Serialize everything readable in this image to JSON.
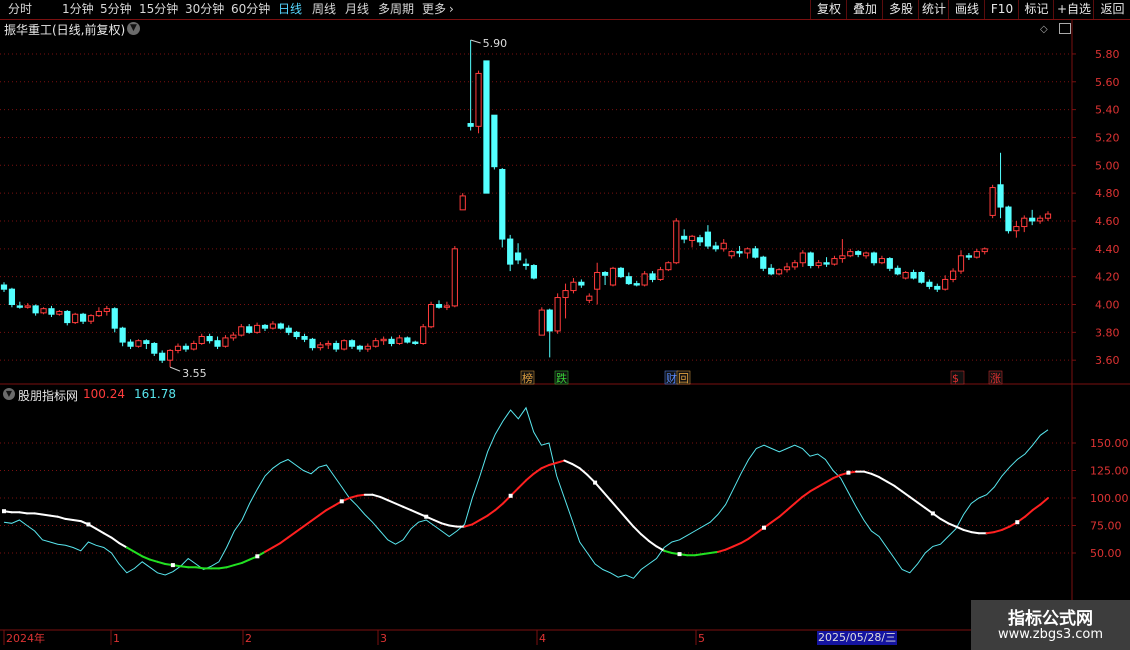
{
  "toolbar": {
    "periods": [
      "分时",
      "1分钟",
      "5分钟",
      "15分钟",
      "30分钟",
      "60分钟",
      "日线",
      "周线",
      "月线",
      "多周期",
      "更多"
    ],
    "active_period": "日线",
    "right_buttons": [
      "复权",
      "叠加",
      "多股",
      "统计",
      "画线",
      "F10",
      "标记",
      "+自选",
      "返回"
    ]
  },
  "main_chart": {
    "title": "振华重工(日线,前复权)",
    "y_ticks": [
      "5.80",
      "5.60",
      "5.40",
      "5.20",
      "5.00",
      "4.80",
      "4.60",
      "4.40",
      "4.20",
      "4.00",
      "3.80",
      "3.60"
    ],
    "high_label": "5.90",
    "low_label": "3.55",
    "event_markers": [
      {
        "text": "榜",
        "color": "#e0a040"
      },
      {
        "text": "跌",
        "color": "#36d336"
      },
      {
        "text": "财",
        "color": "#5a8cff"
      },
      {
        "text": "回",
        "color": "#e0a040"
      },
      {
        "text": "$",
        "color": "#e03030"
      },
      {
        "text": "涨",
        "color": "#e03030"
      }
    ]
  },
  "indicator": {
    "name": "股朋指标网",
    "value_red": "100.24",
    "value_cyan": "161.78",
    "y_ticks": [
      "150.00",
      "125.00",
      "100.00",
      "75.00",
      "50.00"
    ]
  },
  "date_axis": {
    "labels": [
      "2024年",
      "1",
      "2",
      "3",
      "4",
      "5"
    ],
    "cursor_date": "2025/05/28/三"
  },
  "watermark": {
    "title": "指标公式网",
    "url": "www.zbgs3.com"
  },
  "colors": {
    "up": "#ff3c3c",
    "down": "#54ffff",
    "grid": "#7a1010",
    "ma_white": "#ffffff",
    "ma_red": "#ff2020",
    "ma_green": "#22e022",
    "osc": "#58e6ee"
  },
  "chart_data": {
    "type": "candlestick",
    "title": "振华重工(日线,前复权)",
    "ylim": [
      3.52,
      5.95
    ],
    "candles": [
      [
        4.14,
        4.16,
        4.09,
        4.11
      ],
      [
        4.11,
        4.12,
        3.98,
        4.0
      ],
      [
        3.99,
        4.02,
        3.97,
        3.98
      ],
      [
        3.98,
        4.01,
        3.97,
        3.99
      ],
      [
        3.99,
        4.0,
        3.92,
        3.94
      ],
      [
        3.94,
        3.98,
        3.93,
        3.97
      ],
      [
        3.97,
        3.99,
        3.91,
        3.93
      ],
      [
        3.93,
        3.96,
        3.92,
        3.95
      ],
      [
        3.95,
        3.96,
        3.85,
        3.87
      ],
      [
        3.87,
        3.94,
        3.86,
        3.93
      ],
      [
        3.93,
        3.94,
        3.86,
        3.88
      ],
      [
        3.88,
        3.93,
        3.86,
        3.92
      ],
      [
        3.92,
        3.98,
        3.91,
        3.95
      ],
      [
        3.95,
        3.99,
        3.92,
        3.97
      ],
      [
        3.97,
        3.98,
        3.8,
        3.83
      ],
      [
        3.83,
        3.84,
        3.7,
        3.73
      ],
      [
        3.73,
        3.75,
        3.68,
        3.7
      ],
      [
        3.7,
        3.75,
        3.69,
        3.74
      ],
      [
        3.74,
        3.75,
        3.68,
        3.72
      ],
      [
        3.72,
        3.73,
        3.63,
        3.65
      ],
      [
        3.65,
        3.67,
        3.58,
        3.6
      ],
      [
        3.6,
        3.68,
        3.55,
        3.67
      ],
      [
        3.67,
        3.72,
        3.65,
        3.7
      ],
      [
        3.7,
        3.72,
        3.66,
        3.68
      ],
      [
        3.68,
        3.74,
        3.67,
        3.72
      ],
      [
        3.72,
        3.79,
        3.71,
        3.77
      ],
      [
        3.77,
        3.79,
        3.72,
        3.74
      ],
      [
        3.74,
        3.77,
        3.68,
        3.7
      ],
      [
        3.7,
        3.78,
        3.69,
        3.76
      ],
      [
        3.76,
        3.8,
        3.74,
        3.78
      ],
      [
        3.78,
        3.86,
        3.77,
        3.84
      ],
      [
        3.84,
        3.86,
        3.79,
        3.8
      ],
      [
        3.8,
        3.87,
        3.79,
        3.85
      ],
      [
        3.85,
        3.86,
        3.81,
        3.83
      ],
      [
        3.83,
        3.88,
        3.82,
        3.86
      ],
      [
        3.86,
        3.87,
        3.82,
        3.83
      ],
      [
        3.83,
        3.85,
        3.78,
        3.8
      ],
      [
        3.8,
        3.81,
        3.75,
        3.77
      ],
      [
        3.77,
        3.79,
        3.73,
        3.75
      ],
      [
        3.75,
        3.76,
        3.67,
        3.69
      ],
      [
        3.69,
        3.73,
        3.67,
        3.71
      ],
      [
        3.71,
        3.74,
        3.68,
        3.72
      ],
      [
        3.72,
        3.74,
        3.66,
        3.68
      ],
      [
        3.68,
        3.75,
        3.67,
        3.74
      ],
      [
        3.74,
        3.75,
        3.68,
        3.7
      ],
      [
        3.7,
        3.71,
        3.66,
        3.68
      ],
      [
        3.68,
        3.72,
        3.66,
        3.7
      ],
      [
        3.7,
        3.76,
        3.69,
        3.74
      ],
      [
        3.74,
        3.77,
        3.71,
        3.75
      ],
      [
        3.75,
        3.77,
        3.7,
        3.72
      ],
      [
        3.72,
        3.78,
        3.71,
        3.76
      ],
      [
        3.76,
        3.77,
        3.72,
        3.73
      ],
      [
        3.73,
        3.74,
        3.71,
        3.72
      ],
      [
        3.72,
        3.86,
        3.71,
        3.84
      ],
      [
        3.84,
        4.02,
        3.83,
        4.0
      ],
      [
        4.0,
        4.03,
        3.97,
        3.98
      ],
      [
        3.98,
        4.02,
        3.96,
        3.99
      ],
      [
        3.99,
        4.42,
        3.98,
        4.4
      ],
      [
        4.68,
        4.8,
        4.69,
        4.78
      ],
      [
        5.3,
        5.9,
        5.25,
        5.28
      ],
      [
        5.28,
        5.68,
        5.23,
        5.66
      ],
      [
        5.75,
        5.75,
        4.8,
        4.8
      ],
      [
        5.36,
        5.36,
        4.97,
        4.99
      ],
      [
        4.97,
        4.98,
        4.41,
        4.47
      ],
      [
        4.47,
        4.5,
        4.24,
        4.29
      ],
      [
        4.37,
        4.44,
        4.29,
        4.32
      ],
      [
        4.29,
        4.33,
        4.25,
        4.28
      ],
      [
        4.28,
        4.29,
        4.18,
        4.19
      ],
      [
        3.78,
        3.98,
        3.78,
        3.96
      ],
      [
        3.96,
        3.97,
        3.62,
        3.81
      ],
      [
        3.81,
        4.08,
        3.79,
        4.05
      ],
      [
        4.05,
        4.15,
        3.9,
        4.1
      ],
      [
        4.1,
        4.19,
        4.08,
        4.16
      ],
      [
        4.16,
        4.18,
        4.12,
        4.14
      ],
      [
        4.03,
        4.08,
        4.01,
        4.06
      ],
      [
        4.11,
        4.3,
        4.0,
        4.23
      ],
      [
        4.23,
        4.24,
        4.14,
        4.21
      ],
      [
        4.14,
        4.27,
        4.13,
        4.26
      ],
      [
        4.26,
        4.27,
        4.19,
        4.2
      ],
      [
        4.2,
        4.23,
        4.14,
        4.15
      ],
      [
        4.15,
        4.17,
        4.13,
        4.14
      ],
      [
        4.14,
        4.24,
        4.13,
        4.22
      ],
      [
        4.22,
        4.24,
        4.16,
        4.18
      ],
      [
        4.18,
        4.27,
        4.17,
        4.25
      ],
      [
        4.25,
        4.31,
        4.24,
        4.3
      ],
      [
        4.3,
        4.62,
        4.29,
        4.6
      ],
      [
        4.49,
        4.54,
        4.44,
        4.47
      ],
      [
        4.46,
        4.5,
        4.41,
        4.49
      ],
      [
        4.48,
        4.5,
        4.42,
        4.45
      ],
      [
        4.52,
        4.57,
        4.4,
        4.42
      ],
      [
        4.42,
        4.45,
        4.38,
        4.4
      ],
      [
        4.4,
        4.47,
        4.38,
        4.44
      ],
      [
        4.35,
        4.39,
        4.33,
        4.38
      ],
      [
        4.38,
        4.42,
        4.34,
        4.37
      ],
      [
        4.37,
        4.41,
        4.33,
        4.4
      ],
      [
        4.4,
        4.42,
        4.33,
        4.34
      ],
      [
        4.34,
        4.35,
        4.24,
        4.26
      ],
      [
        4.26,
        4.29,
        4.21,
        4.22
      ],
      [
        4.22,
        4.26,
        4.21,
        4.25
      ],
      [
        4.25,
        4.3,
        4.23,
        4.27
      ],
      [
        4.27,
        4.32,
        4.25,
        4.3
      ],
      [
        4.3,
        4.39,
        4.27,
        4.37
      ],
      [
        4.37,
        4.38,
        4.26,
        4.28
      ],
      [
        4.28,
        4.32,
        4.26,
        4.3
      ],
      [
        4.3,
        4.34,
        4.27,
        4.29
      ],
      [
        4.29,
        4.35,
        4.28,
        4.33
      ],
      [
        4.33,
        4.47,
        4.3,
        4.35
      ],
      [
        4.35,
        4.4,
        4.34,
        4.38
      ],
      [
        4.38,
        4.39,
        4.34,
        4.36
      ],
      [
        4.35,
        4.38,
        4.33,
        4.37
      ],
      [
        4.37,
        4.38,
        4.28,
        4.3
      ],
      [
        4.3,
        4.35,
        4.29,
        4.33
      ],
      [
        4.33,
        4.34,
        4.24,
        4.26
      ],
      [
        4.26,
        4.28,
        4.21,
        4.22
      ],
      [
        4.19,
        4.24,
        4.18,
        4.23
      ],
      [
        4.23,
        4.25,
        4.18,
        4.19
      ],
      [
        4.23,
        4.24,
        4.15,
        4.16
      ],
      [
        4.16,
        4.18,
        4.11,
        4.13
      ],
      [
        4.13,
        4.15,
        4.09,
        4.11
      ],
      [
        4.11,
        4.21,
        4.1,
        4.18
      ],
      [
        4.18,
        4.26,
        4.16,
        4.24
      ],
      [
        4.24,
        4.39,
        4.22,
        4.35
      ],
      [
        4.35,
        4.37,
        4.32,
        4.34
      ],
      [
        4.34,
        4.4,
        4.33,
        4.38
      ],
      [
        4.38,
        4.41,
        4.36,
        4.4
      ],
      [
        4.64,
        4.86,
        4.62,
        4.84
      ],
      [
        4.86,
        5.09,
        4.62,
        4.7
      ],
      [
        4.7,
        4.71,
        4.51,
        4.53
      ],
      [
        4.53,
        4.6,
        4.48,
        4.56
      ],
      [
        4.56,
        4.64,
        4.52,
        4.62
      ],
      [
        4.62,
        4.68,
        4.57,
        4.6
      ],
      [
        4.6,
        4.64,
        4.58,
        4.62
      ],
      [
        4.62,
        4.67,
        4.6,
        4.65
      ]
    ],
    "indicator_cyan": [
      78,
      77,
      80,
      75,
      70,
      62,
      60,
      58,
      57,
      55,
      52,
      60,
      57,
      55,
      50,
      40,
      32,
      36,
      42,
      37,
      32,
      30,
      33,
      38,
      45,
      40,
      35,
      38,
      42,
      55,
      70,
      80,
      95,
      108,
      120,
      127,
      132,
      135,
      130,
      125,
      122,
      128,
      130,
      120,
      110,
      100,
      93,
      85,
      78,
      70,
      62,
      58,
      62,
      72,
      78,
      80,
      75,
      70,
      65,
      70,
      76,
      100,
      120,
      142,
      158,
      170,
      180,
      172,
      182,
      160,
      148,
      150,
      120,
      100,
      80,
      60,
      50,
      40,
      35,
      32,
      28,
      30,
      27,
      35,
      40,
      45,
      55,
      60,
      62,
      66,
      70,
      74,
      78,
      85,
      94,
      108,
      122,
      135,
      145,
      148,
      145,
      142,
      145,
      148,
      145,
      138,
      140,
      135,
      125,
      118,
      105,
      92,
      80,
      70,
      65,
      55,
      45,
      35,
      32,
      40,
      50,
      56,
      58,
      65,
      72,
      85,
      95,
      100,
      103,
      110,
      120,
      128,
      135,
      140,
      148,
      157,
      162
    ],
    "indicator_line": [
      88,
      87,
      87,
      86,
      86,
      85,
      84,
      83,
      81,
      80,
      79,
      76,
      72,
      68,
      64,
      59,
      55,
      51,
      47,
      44,
      42,
      40,
      39,
      38,
      37,
      37,
      36,
      36,
      36,
      37,
      39,
      41,
      44,
      47,
      51,
      55,
      59,
      64,
      69,
      74,
      79,
      84,
      89,
      93,
      97,
      100,
      102,
      103,
      103,
      101,
      98,
      95,
      92,
      89,
      86,
      83,
      80,
      77,
      75,
      74,
      74,
      76,
      80,
      84,
      89,
      95,
      102,
      109,
      116,
      122,
      127,
      130,
      132,
      134,
      131,
      127,
      121,
      114,
      106,
      98,
      90,
      82,
      74,
      67,
      61,
      56,
      52,
      50,
      49,
      48,
      48,
      49,
      50,
      51,
      53,
      56,
      59,
      63,
      68,
      73,
      78,
      83,
      89,
      95,
      101,
      106,
      110,
      114,
      118,
      121,
      123,
      124,
      124,
      122,
      119,
      115,
      111,
      106,
      101,
      96,
      91,
      86,
      81,
      77,
      74,
      71,
      69,
      68,
      68,
      69,
      71,
      74,
      78,
      83,
      89,
      94,
      100
    ]
  }
}
